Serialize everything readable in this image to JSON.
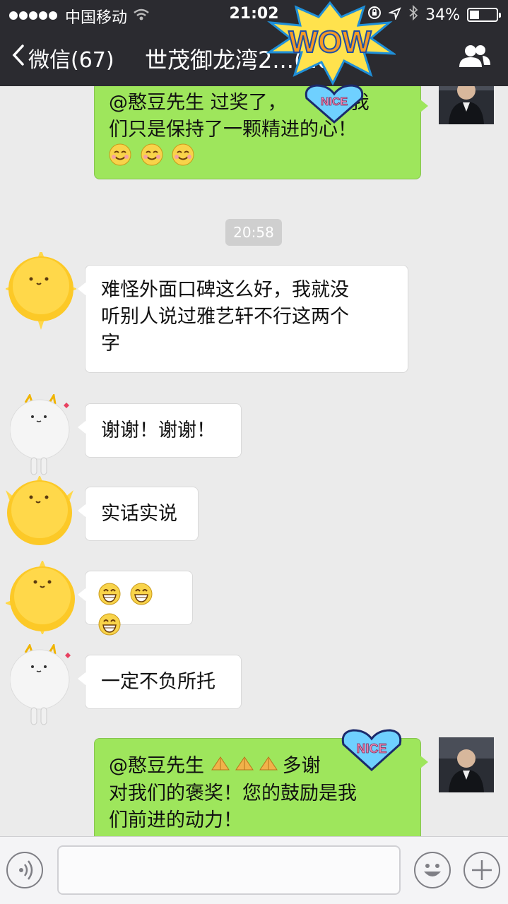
{
  "status_bar": {
    "carrier": "中国移动",
    "time": "21:02",
    "battery": "34%"
  },
  "nav": {
    "back_label": "微信(67)",
    "title": "世茂御龙湾2...(10)"
  },
  "messages": [
    {
      "side": "out",
      "text_line1": "@憨豆先生 过奖了，",
      "text_line1_tail": "我",
      "text_line2": "们只是保持了一颗精进的心！"
    },
    {
      "side": "in",
      "text_line1": "难怪外面口碑这么好，我就没",
      "text_line2": "听别人说过雅艺轩不行这两个",
      "text_line3": "字"
    },
    {
      "side": "in",
      "text": "谢谢！谢谢！"
    },
    {
      "side": "in",
      "text": "实话实说"
    },
    {
      "side": "in",
      "emoji": "grin-emoji"
    },
    {
      "side": "in",
      "text": "一定不负所托"
    },
    {
      "side": "out",
      "text_line1": "@憨豆先生",
      "text_line1_tail": "多谢",
      "text_line2": "对我们的褒奖！您的鼓励是我",
      "text_line3": "们前进的动力！"
    }
  ],
  "timestamp": "20:58",
  "stickers": {
    "wow": "WOW",
    "nice": "NICE"
  },
  "colors": {
    "bar": "#2b2b30",
    "out_bubble": "#9ee65c",
    "background": "#ebebeb"
  }
}
